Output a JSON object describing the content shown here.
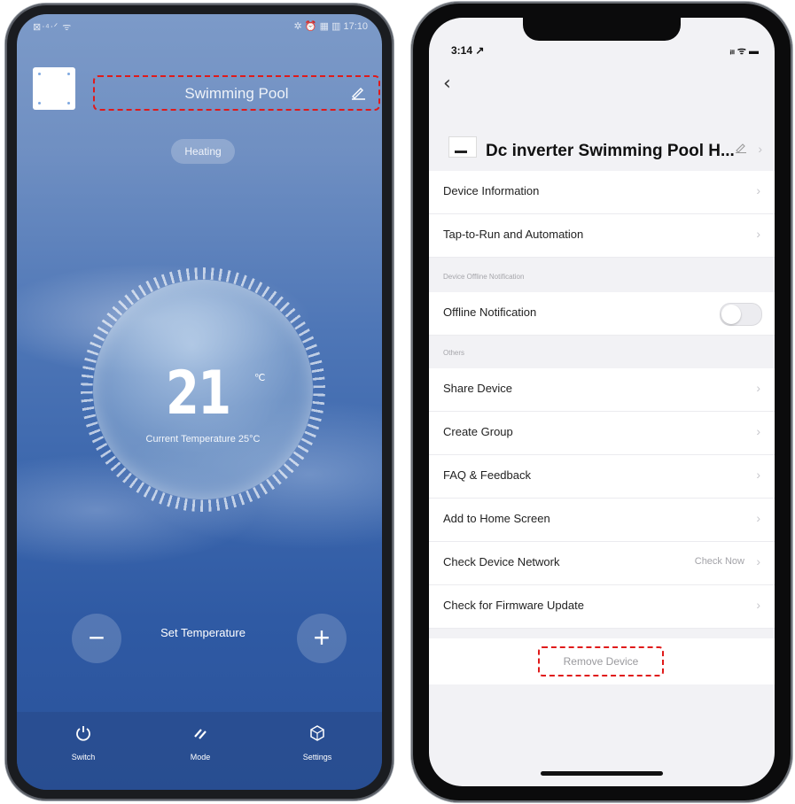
{
  "left_app": {
    "status": {
      "left": "⊠ᐧ⁴ᐧᐟ ᯤ",
      "right": "✲ ⏰ ▦ ▥ 17:10"
    },
    "title": "Swimming Pool",
    "mode_pill": "Heating",
    "set_temp_value": "21",
    "temp_unit": "℃",
    "current_temp": "Current Temperature 25°C",
    "set_temp_label": "Set Temperature",
    "minus": "−",
    "plus": "+",
    "tabs": [
      {
        "label": "Switch",
        "icon": "power-icon"
      },
      {
        "label": "Mode",
        "icon": "mode-icon"
      },
      {
        "label": "Settings",
        "icon": "settings-icon"
      }
    ]
  },
  "right_app": {
    "status": {
      "time": "3:14 ↗",
      "indicators": "ᵢₗₗ ᯤ ▬"
    },
    "back": "‹",
    "device_name": "Dc inverter Swimming Pool H...",
    "rows_top": [
      {
        "label": "Device Information"
      },
      {
        "label": "Tap-to-Run and Automation"
      }
    ],
    "section_offline": "Device Offline Notification",
    "offline_row": {
      "label": "Offline Notification",
      "enabled": false
    },
    "section_others": "Others",
    "rows_others": [
      {
        "label": "Share Device"
      },
      {
        "label": "Create Group"
      },
      {
        "label": "FAQ & Feedback"
      },
      {
        "label": "Add to Home Screen"
      },
      {
        "label": "Check Device Network",
        "value": "Check Now"
      },
      {
        "label": "Check for Firmware Update"
      }
    ],
    "remove": "Remove Device"
  },
  "colors": {
    "highlight_dash": "#e01a1a",
    "left_bg_top": "#7c9ac8",
    "left_bg_bottom": "#2a529a",
    "right_bg": "#f2f2f5"
  }
}
